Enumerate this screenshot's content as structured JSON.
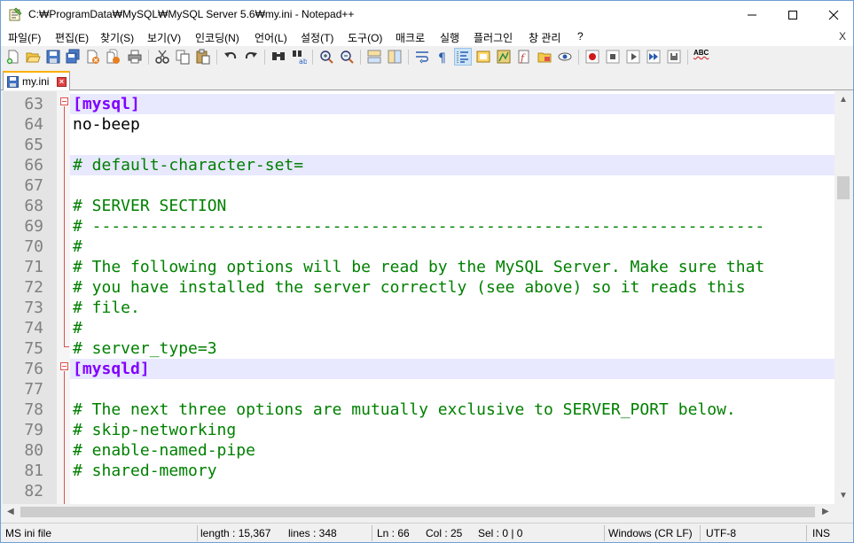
{
  "window": {
    "title": "C:₩ProgramData₩MySQL₩MySQL Server 5.6₩my.ini - Notepad++"
  },
  "menu": {
    "items": [
      "파일(F)",
      "편집(E)",
      "찾기(S)",
      "보기(V)",
      "인코딩(N)",
      "언어(L)",
      "설정(T)",
      "도구(O)",
      "매크로",
      "실행",
      "플러그인",
      "창 관리",
      "?"
    ],
    "close_label": "X"
  },
  "toolbar": {
    "icons": [
      "new-file-icon",
      "open-file-icon",
      "save-icon",
      "save-all-icon",
      "close-icon",
      "close-all-icon",
      "print-icon",
      "cut-icon",
      "copy-icon",
      "paste-icon",
      "undo-icon",
      "redo-icon",
      "find-icon",
      "replace-icon",
      "zoom-in-icon",
      "zoom-out-icon",
      "sync-vertical-icon",
      "sync-horizontal-icon",
      "word-wrap-icon",
      "show-all-chars-icon",
      "indent-guide-icon",
      "udl-icon",
      "doc-map-icon",
      "function-list-icon",
      "folder-workspace-icon",
      "monitoring-icon",
      "record-macro-icon",
      "stop-record-icon",
      "play-macro-icon",
      "run-macro-multiple-icon",
      "save-macro-icon",
      "spell-check-icon"
    ],
    "spell_label": "ABC"
  },
  "tab": {
    "label": "my.ini",
    "close_label": "×"
  },
  "editor": {
    "lines": [
      {
        "num": "63",
        "text": "[mysql]",
        "type": "section",
        "hl": true
      },
      {
        "num": "64",
        "text": "no-beep",
        "type": "key",
        "hl": false
      },
      {
        "num": "65",
        "text": "",
        "type": "key",
        "hl": false
      },
      {
        "num": "66",
        "text": "# default-character-set=",
        "type": "comment",
        "hl": true
      },
      {
        "num": "67",
        "text": "",
        "type": "key",
        "hl": false
      },
      {
        "num": "68",
        "text": "# SERVER SECTION",
        "type": "comment",
        "hl": false
      },
      {
        "num": "69",
        "text": "# ----------------------------------------------------------------------",
        "type": "comment",
        "hl": false
      },
      {
        "num": "70",
        "text": "#",
        "type": "comment",
        "hl": false
      },
      {
        "num": "71",
        "text": "# The following options will be read by the MySQL Server. Make sure that",
        "type": "comment",
        "hl": false
      },
      {
        "num": "72",
        "text": "# you have installed the server correctly (see above) so it reads this",
        "type": "comment",
        "hl": false
      },
      {
        "num": "73",
        "text": "# file.",
        "type": "comment",
        "hl": false
      },
      {
        "num": "74",
        "text": "#",
        "type": "comment",
        "hl": false
      },
      {
        "num": "75",
        "text": "# server_type=3",
        "type": "comment",
        "hl": false
      },
      {
        "num": "76",
        "text": "[mysqld]",
        "type": "section",
        "hl": true
      },
      {
        "num": "77",
        "text": "",
        "type": "key",
        "hl": false
      },
      {
        "num": "78",
        "text": "# The next three options are mutually exclusive to SERVER_PORT below.",
        "type": "comment",
        "hl": false
      },
      {
        "num": "79",
        "text": "# skip-networking",
        "type": "comment",
        "hl": false
      },
      {
        "num": "80",
        "text": "# enable-named-pipe",
        "type": "comment",
        "hl": false
      },
      {
        "num": "81",
        "text": "# shared-memory",
        "type": "comment",
        "hl": false
      },
      {
        "num": "82",
        "text": "",
        "type": "key",
        "hl": false
      }
    ]
  },
  "status": {
    "file_type": "MS ini file",
    "length": "length : 15,367",
    "lines": "lines : 348",
    "ln": "Ln : 66",
    "col": "Col : 25",
    "sel": "Sel : 0 | 0",
    "eol": "Windows (CR LF)",
    "encoding": "UTF-8",
    "mode": "INS"
  },
  "colors": {
    "section": "#8000ff",
    "comment": "#008000",
    "line_highlight": "#e8e8ff",
    "fold_marker": "#e05050"
  }
}
